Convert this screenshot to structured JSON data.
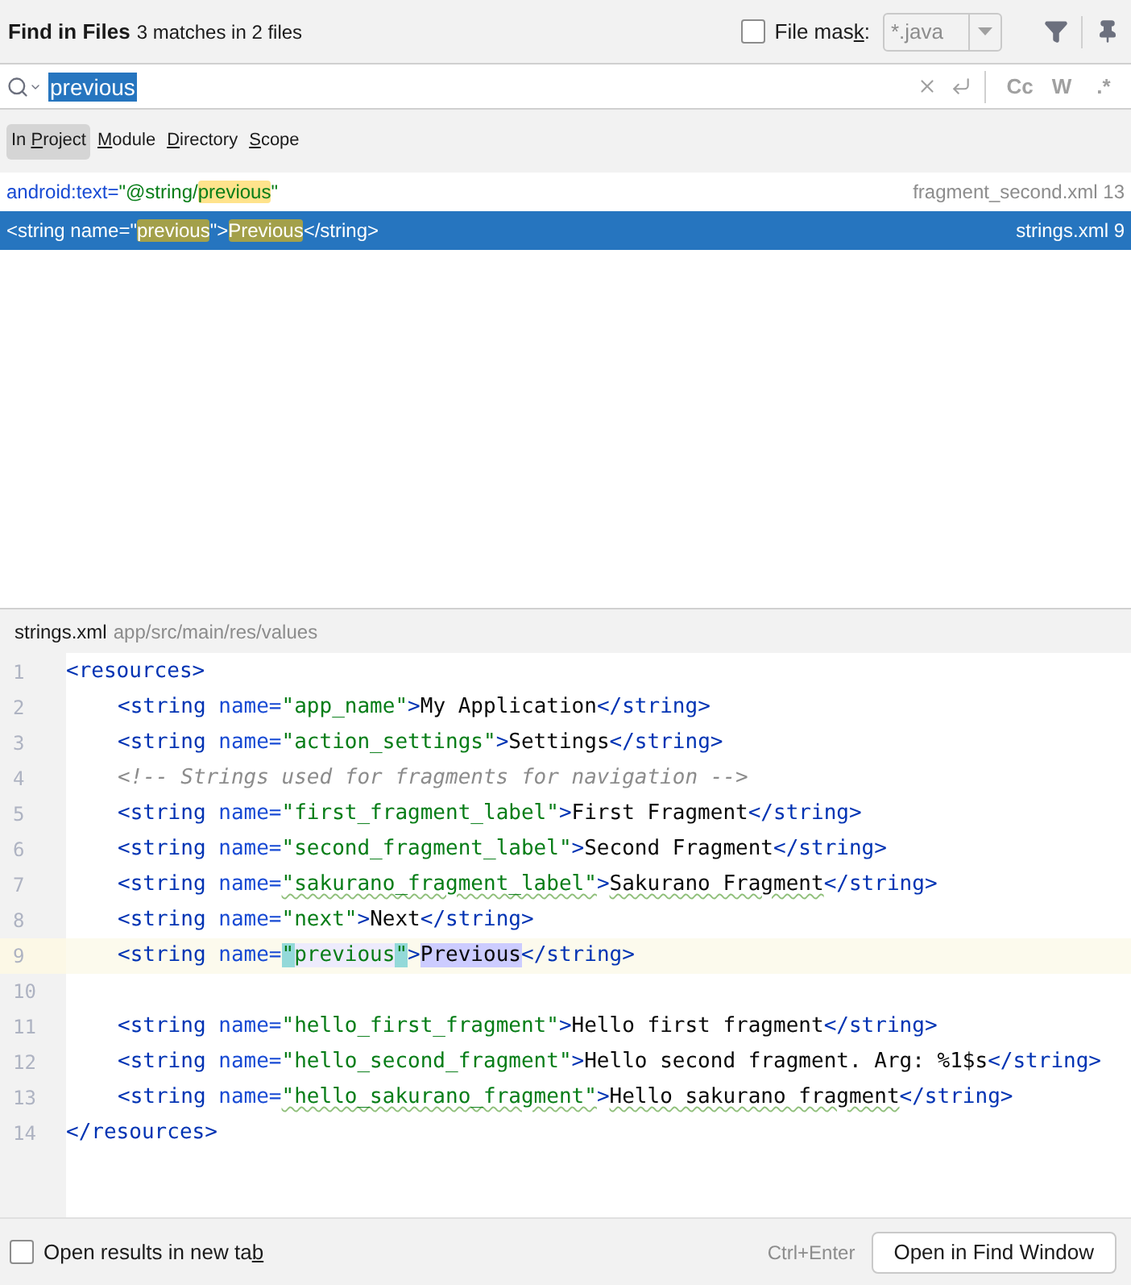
{
  "header": {
    "title": "Find in Files",
    "summary": "3 matches in 2 files",
    "file_mask": {
      "checked": false,
      "label": {
        "before": "File mas",
        "key": "k",
        "after": ":"
      },
      "value": "*.java"
    }
  },
  "search": {
    "value": "previous",
    "options": [
      {
        "label": "Cc"
      },
      {
        "label": "W"
      },
      {
        "label": ".*"
      }
    ]
  },
  "scopes": [
    {
      "before": "In ",
      "key": "P",
      "after": "roject",
      "selected": true
    },
    {
      "key": "M",
      "after": "odule",
      "selected": false
    },
    {
      "key": "D",
      "after": "irectory",
      "selected": false
    },
    {
      "key": "S",
      "after": "cope",
      "selected": false
    }
  ],
  "results": [
    {
      "selected": false,
      "file": "fragment_second.xml 13",
      "segments": [
        {
          "kind": "attr",
          "text": "android:text=",
          "match": false
        },
        {
          "kind": "value",
          "text": "\"@string/",
          "match": false
        },
        {
          "kind": "value",
          "text": "previous",
          "match": true
        },
        {
          "kind": "value",
          "text": "\"",
          "match": false
        }
      ]
    },
    {
      "selected": true,
      "file": "strings.xml 9",
      "segments": [
        {
          "kind": "plain",
          "text": "<string name=\"",
          "match": false
        },
        {
          "kind": "plain",
          "text": "previous",
          "match": true
        },
        {
          "kind": "plain",
          "text": "\">",
          "match": false
        },
        {
          "kind": "plain",
          "text": "Previous",
          "match": true
        },
        {
          "kind": "plain",
          "text": "</string>",
          "match": false
        }
      ]
    }
  ],
  "preview": {
    "file": "strings.xml",
    "path": "app/src/main/res/values",
    "lines": [
      {
        "number": "1",
        "current": false,
        "indent": false,
        "segments": [
          {
            "kind": "tag",
            "text": "<resources>"
          }
        ]
      },
      {
        "number": "2",
        "current": false,
        "indent": true,
        "segments": [
          {
            "kind": "tag",
            "text": "<string"
          },
          {
            "kind": "attr",
            "text": " name="
          },
          {
            "kind": "value",
            "text": "\"app_name\""
          },
          {
            "kind": "tag",
            "text": ">"
          },
          {
            "kind": "text",
            "text": "My Application"
          },
          {
            "kind": "tag",
            "text": "</string>"
          }
        ]
      },
      {
        "number": "3",
        "current": false,
        "indent": true,
        "segments": [
          {
            "kind": "tag",
            "text": "<string"
          },
          {
            "kind": "attr",
            "text": " name="
          },
          {
            "kind": "value",
            "text": "\"action_settings\""
          },
          {
            "kind": "tag",
            "text": ">"
          },
          {
            "kind": "text",
            "text": "Settings"
          },
          {
            "kind": "tag",
            "text": "</string>"
          }
        ]
      },
      {
        "number": "4",
        "current": false,
        "indent": true,
        "segments": [
          {
            "kind": "comment",
            "text": "<!-- Strings used for fragments for navigation -->"
          }
        ]
      },
      {
        "number": "5",
        "current": false,
        "indent": true,
        "segments": [
          {
            "kind": "tag",
            "text": "<string"
          },
          {
            "kind": "attr",
            "text": " name="
          },
          {
            "kind": "value",
            "text": "\"first_fragment_label\""
          },
          {
            "kind": "tag",
            "text": ">"
          },
          {
            "kind": "text",
            "text": "First Fragment"
          },
          {
            "kind": "tag",
            "text": "</string>"
          }
        ]
      },
      {
        "number": "6",
        "current": false,
        "indent": true,
        "segments": [
          {
            "kind": "tag",
            "text": "<string"
          },
          {
            "kind": "attr",
            "text": " name="
          },
          {
            "kind": "value",
            "text": "\"second_fragment_label\""
          },
          {
            "kind": "tag",
            "text": ">"
          },
          {
            "kind": "text",
            "text": "Second Fragment"
          },
          {
            "kind": "tag",
            "text": "</string>"
          }
        ]
      },
      {
        "number": "7",
        "current": false,
        "indent": true,
        "segments": [
          {
            "kind": "tag",
            "text": "<string"
          },
          {
            "kind": "attr",
            "text": " name="
          },
          {
            "kind": "value",
            "text": "\"sakurano_fragment_label\"",
            "squiggle": true
          },
          {
            "kind": "tag",
            "text": ">"
          },
          {
            "kind": "text",
            "text": "Sakurano Fragment",
            "squiggle": true
          },
          {
            "kind": "tag",
            "text": "</string>"
          }
        ]
      },
      {
        "number": "8",
        "current": false,
        "indent": true,
        "segments": [
          {
            "kind": "tag",
            "text": "<string"
          },
          {
            "kind": "attr",
            "text": " name="
          },
          {
            "kind": "value",
            "text": "\"next\""
          },
          {
            "kind": "tag",
            "text": ">"
          },
          {
            "kind": "text",
            "text": "Next"
          },
          {
            "kind": "tag",
            "text": "</string>"
          }
        ]
      },
      {
        "number": "9",
        "current": true,
        "indent": true,
        "segments": [
          {
            "kind": "tag",
            "text": "<string"
          },
          {
            "kind": "attr",
            "text": " name="
          },
          {
            "kind": "value-brace",
            "text": "\""
          },
          {
            "kind": "value-usage",
            "text": "previous"
          },
          {
            "kind": "value-brace",
            "text": "\""
          },
          {
            "kind": "tag",
            "text": ">"
          },
          {
            "kind": "text-match",
            "text": "Previous"
          },
          {
            "kind": "tag",
            "text": "</string>"
          }
        ]
      },
      {
        "number": "10",
        "current": false
      },
      {
        "number": "11",
        "current": false,
        "indent": true,
        "segments": [
          {
            "kind": "tag",
            "text": "<string"
          },
          {
            "kind": "attr",
            "text": " name="
          },
          {
            "kind": "value",
            "text": "\"hello_first_fragment\""
          },
          {
            "kind": "tag",
            "text": ">"
          },
          {
            "kind": "text",
            "text": "Hello first fragment"
          },
          {
            "kind": "tag",
            "text": "</string>"
          }
        ]
      },
      {
        "number": "12",
        "current": false,
        "indent": true,
        "segments": [
          {
            "kind": "tag",
            "text": "<string"
          },
          {
            "kind": "attr",
            "text": " name="
          },
          {
            "kind": "value",
            "text": "\"hello_second_fragment\""
          },
          {
            "kind": "tag",
            "text": ">"
          },
          {
            "kind": "text",
            "text": "Hello second fragment. Arg: %1$s"
          },
          {
            "kind": "tag",
            "text": "</string>"
          }
        ]
      },
      {
        "number": "13",
        "current": false,
        "indent": true,
        "segments": [
          {
            "kind": "tag",
            "text": "<string"
          },
          {
            "kind": "attr",
            "text": " name="
          },
          {
            "kind": "value",
            "text": "\"hello_sakurano_fragment\"",
            "squiggle": true
          },
          {
            "kind": "tag",
            "text": ">"
          },
          {
            "kind": "text",
            "text": "Hello sakurano fragment",
            "squiggle": true
          },
          {
            "kind": "tag",
            "text": "</string>"
          }
        ]
      },
      {
        "number": "14",
        "current": false,
        "indent": false,
        "segments": [
          {
            "kind": "tag",
            "text": "</resources>"
          }
        ]
      }
    ]
  },
  "footer": {
    "new_tab": {
      "checked": false,
      "label": {
        "before": "Open results in new ta",
        "key": "b"
      }
    },
    "shortcut": "Ctrl+Enter",
    "button": "Open in Find Window"
  }
}
